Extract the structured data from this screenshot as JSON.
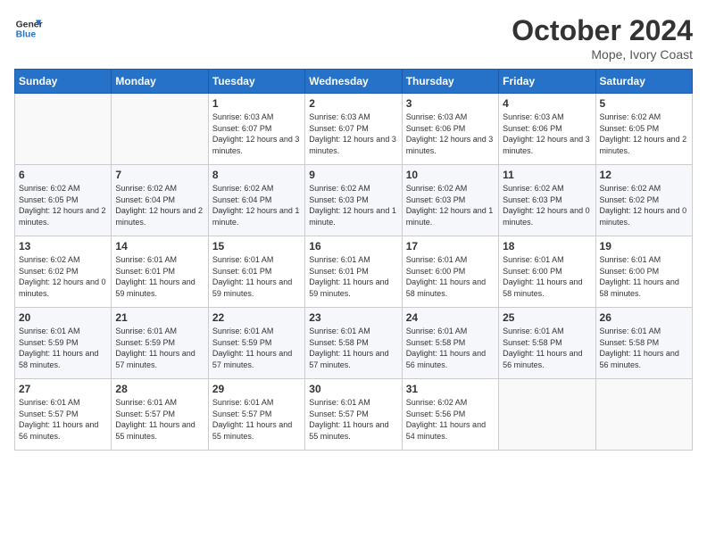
{
  "header": {
    "logo_line1": "General",
    "logo_line2": "Blue",
    "month": "October 2024",
    "location": "Mope, Ivory Coast"
  },
  "weekdays": [
    "Sunday",
    "Monday",
    "Tuesday",
    "Wednesday",
    "Thursday",
    "Friday",
    "Saturday"
  ],
  "weeks": [
    [
      {
        "day": "",
        "info": ""
      },
      {
        "day": "",
        "info": ""
      },
      {
        "day": "1",
        "info": "Sunrise: 6:03 AM\nSunset: 6:07 PM\nDaylight: 12 hours and 3 minutes."
      },
      {
        "day": "2",
        "info": "Sunrise: 6:03 AM\nSunset: 6:07 PM\nDaylight: 12 hours and 3 minutes."
      },
      {
        "day": "3",
        "info": "Sunrise: 6:03 AM\nSunset: 6:06 PM\nDaylight: 12 hours and 3 minutes."
      },
      {
        "day": "4",
        "info": "Sunrise: 6:03 AM\nSunset: 6:06 PM\nDaylight: 12 hours and 3 minutes."
      },
      {
        "day": "5",
        "info": "Sunrise: 6:02 AM\nSunset: 6:05 PM\nDaylight: 12 hours and 2 minutes."
      }
    ],
    [
      {
        "day": "6",
        "info": "Sunrise: 6:02 AM\nSunset: 6:05 PM\nDaylight: 12 hours and 2 minutes."
      },
      {
        "day": "7",
        "info": "Sunrise: 6:02 AM\nSunset: 6:04 PM\nDaylight: 12 hours and 2 minutes."
      },
      {
        "day": "8",
        "info": "Sunrise: 6:02 AM\nSunset: 6:04 PM\nDaylight: 12 hours and 1 minute."
      },
      {
        "day": "9",
        "info": "Sunrise: 6:02 AM\nSunset: 6:03 PM\nDaylight: 12 hours and 1 minute."
      },
      {
        "day": "10",
        "info": "Sunrise: 6:02 AM\nSunset: 6:03 PM\nDaylight: 12 hours and 1 minute."
      },
      {
        "day": "11",
        "info": "Sunrise: 6:02 AM\nSunset: 6:03 PM\nDaylight: 12 hours and 0 minutes."
      },
      {
        "day": "12",
        "info": "Sunrise: 6:02 AM\nSunset: 6:02 PM\nDaylight: 12 hours and 0 minutes."
      }
    ],
    [
      {
        "day": "13",
        "info": "Sunrise: 6:02 AM\nSunset: 6:02 PM\nDaylight: 12 hours and 0 minutes."
      },
      {
        "day": "14",
        "info": "Sunrise: 6:01 AM\nSunset: 6:01 PM\nDaylight: 11 hours and 59 minutes."
      },
      {
        "day": "15",
        "info": "Sunrise: 6:01 AM\nSunset: 6:01 PM\nDaylight: 11 hours and 59 minutes."
      },
      {
        "day": "16",
        "info": "Sunrise: 6:01 AM\nSunset: 6:01 PM\nDaylight: 11 hours and 59 minutes."
      },
      {
        "day": "17",
        "info": "Sunrise: 6:01 AM\nSunset: 6:00 PM\nDaylight: 11 hours and 58 minutes."
      },
      {
        "day": "18",
        "info": "Sunrise: 6:01 AM\nSunset: 6:00 PM\nDaylight: 11 hours and 58 minutes."
      },
      {
        "day": "19",
        "info": "Sunrise: 6:01 AM\nSunset: 6:00 PM\nDaylight: 11 hours and 58 minutes."
      }
    ],
    [
      {
        "day": "20",
        "info": "Sunrise: 6:01 AM\nSunset: 5:59 PM\nDaylight: 11 hours and 58 minutes."
      },
      {
        "day": "21",
        "info": "Sunrise: 6:01 AM\nSunset: 5:59 PM\nDaylight: 11 hours and 57 minutes."
      },
      {
        "day": "22",
        "info": "Sunrise: 6:01 AM\nSunset: 5:59 PM\nDaylight: 11 hours and 57 minutes."
      },
      {
        "day": "23",
        "info": "Sunrise: 6:01 AM\nSunset: 5:58 PM\nDaylight: 11 hours and 57 minutes."
      },
      {
        "day": "24",
        "info": "Sunrise: 6:01 AM\nSunset: 5:58 PM\nDaylight: 11 hours and 56 minutes."
      },
      {
        "day": "25",
        "info": "Sunrise: 6:01 AM\nSunset: 5:58 PM\nDaylight: 11 hours and 56 minutes."
      },
      {
        "day": "26",
        "info": "Sunrise: 6:01 AM\nSunset: 5:58 PM\nDaylight: 11 hours and 56 minutes."
      }
    ],
    [
      {
        "day": "27",
        "info": "Sunrise: 6:01 AM\nSunset: 5:57 PM\nDaylight: 11 hours and 56 minutes."
      },
      {
        "day": "28",
        "info": "Sunrise: 6:01 AM\nSunset: 5:57 PM\nDaylight: 11 hours and 55 minutes."
      },
      {
        "day": "29",
        "info": "Sunrise: 6:01 AM\nSunset: 5:57 PM\nDaylight: 11 hours and 55 minutes."
      },
      {
        "day": "30",
        "info": "Sunrise: 6:01 AM\nSunset: 5:57 PM\nDaylight: 11 hours and 55 minutes."
      },
      {
        "day": "31",
        "info": "Sunrise: 6:02 AM\nSunset: 5:56 PM\nDaylight: 11 hours and 54 minutes."
      },
      {
        "day": "",
        "info": ""
      },
      {
        "day": "",
        "info": ""
      }
    ]
  ]
}
